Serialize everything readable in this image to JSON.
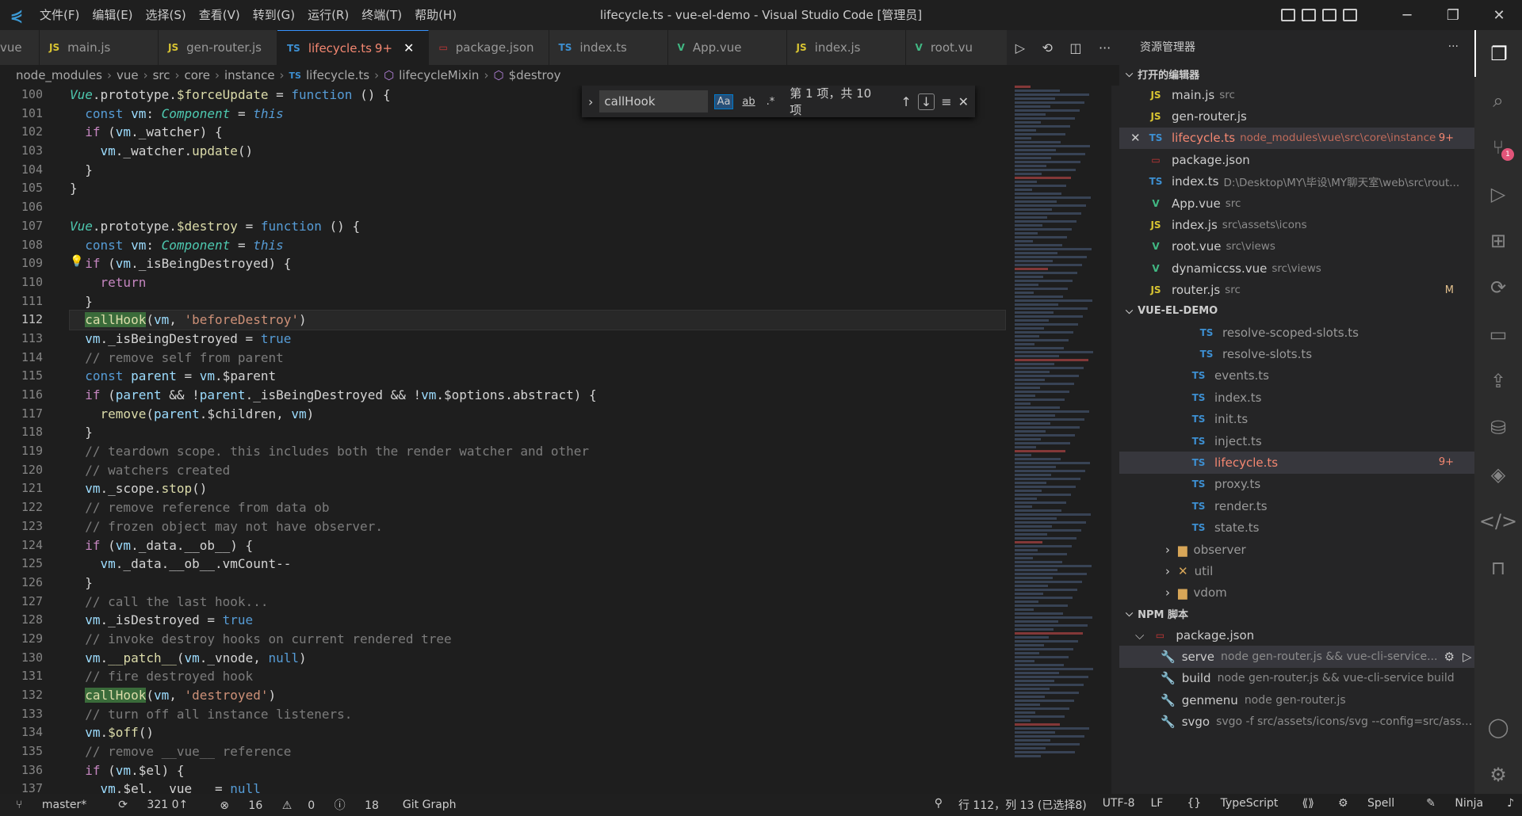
{
  "window": {
    "title": "lifecycle.ts - vue-el-demo - Visual Studio Code [管理员]",
    "menu": [
      "文件(F)",
      "编辑(E)",
      "选择(S)",
      "查看(V)",
      "转到(G)",
      "运行(R)",
      "终端(T)",
      "帮助(H)"
    ],
    "controls": {
      "minimize": "─",
      "maximize": "❐",
      "close": "✕"
    }
  },
  "tabs": [
    {
      "icon": "",
      "label": "vue",
      "type": "vue"
    },
    {
      "icon": "JS",
      "label": "main.js",
      "type": "js"
    },
    {
      "icon": "JS",
      "label": "gen-router.js",
      "type": "js"
    },
    {
      "icon": "TS",
      "label": "lifecycle.ts",
      "type": "ts",
      "active": true,
      "badge": "9+",
      "close": "✕"
    },
    {
      "icon": "▭",
      "label": "package.json",
      "type": "npm"
    },
    {
      "icon": "TS",
      "label": "index.ts",
      "type": "ts"
    },
    {
      "icon": "V",
      "label": "App.vue",
      "type": "vue"
    },
    {
      "icon": "JS",
      "label": "index.js",
      "type": "js"
    },
    {
      "icon": "V",
      "label": "root.vu",
      "type": "vue"
    }
  ],
  "editor_actions": {
    "run": "▷",
    "history": "⟲",
    "split": "◫",
    "more": "···"
  },
  "breadcrumb": [
    "node_modules",
    "vue",
    "src",
    "core",
    "instance",
    "lifecycle.ts",
    "lifecycleMixin",
    "$destroy"
  ],
  "find": {
    "value": "callHook",
    "opt_case": "Aa",
    "opt_word": "ab",
    "opt_regex": ".*",
    "result": "第 1 项，共 10 项",
    "prev": "↑",
    "next": "↓",
    "sel": "≡",
    "close": "✕",
    "toggle": "›"
  },
  "line_numbers": [
    "100",
    "101",
    "102",
    "103",
    "104",
    "105",
    "106",
    "107",
    "108",
    "109",
    "110",
    "111",
    "112",
    "113",
    "114",
    "115",
    "116",
    "117",
    "118",
    "119",
    "120",
    "121",
    "122",
    "123",
    "124",
    "125",
    "126",
    "127",
    "128",
    "129",
    "130",
    "131",
    "132",
    "133",
    "134",
    "135",
    "136",
    "137"
  ],
  "code_plain": {
    "c119": "// teardown scope. this includes both the render watcher and other",
    "c120": "// watchers created",
    "c122": "// remove reference from data ob",
    "c123": "// frozen object may not have observer.",
    "c127": "// call the last hook...",
    "c129": "// invoke destroy hooks on current rendered tree",
    "c131": "// fire destroyed hook",
    "c133": "// turn off all instance listeners.",
    "c135": "// remove __vue__ reference",
    "c114": "// remove self from parent"
  },
  "sidebar": {
    "title": "资源管理器",
    "more": "···",
    "open_editors_title": "打开的编辑器",
    "open_editors": [
      {
        "icon": "JS",
        "type": "js",
        "name": "main.js",
        "desc": "src"
      },
      {
        "icon": "JS",
        "type": "js",
        "name": "gen-router.js",
        "desc": ""
      },
      {
        "icon": "TS",
        "type": "ts",
        "name": "lifecycle.ts",
        "desc": "node_modules\\vue\\src\\core\\instance",
        "badge": "9+",
        "err": true,
        "close": "✕"
      },
      {
        "icon": "▭",
        "type": "npm",
        "name": "package.json",
        "desc": ""
      },
      {
        "icon": "TS",
        "type": "ts",
        "name": "index.ts",
        "desc": "D:\\Desktop\\MY\\毕设\\MY聊天室\\web\\src\\rout..."
      },
      {
        "icon": "V",
        "type": "vue",
        "name": "App.vue",
        "desc": "src"
      },
      {
        "icon": "JS",
        "type": "js",
        "name": "index.js",
        "desc": "src\\assets\\icons"
      },
      {
        "icon": "V",
        "type": "vue",
        "name": "root.vue",
        "desc": "src\\views"
      },
      {
        "icon": "V",
        "type": "vue",
        "name": "dynamiccss.vue",
        "desc": "src\\views"
      },
      {
        "icon": "JS",
        "type": "js",
        "name": "router.js",
        "desc": "src",
        "badge": "M"
      }
    ],
    "project_title": "VUE-EL-DEMO",
    "project_files": [
      {
        "icon": "TS",
        "name": "resolve-scoped-slots.ts",
        "indent": 100
      },
      {
        "icon": "TS",
        "name": "resolve-slots.ts",
        "indent": 100
      },
      {
        "icon": "TS",
        "name": "events.ts",
        "indent": 90
      },
      {
        "icon": "TS",
        "name": "index.ts",
        "indent": 90
      },
      {
        "icon": "TS",
        "name": "init.ts",
        "indent": 90
      },
      {
        "icon": "TS",
        "name": "inject.ts",
        "indent": 90
      },
      {
        "icon": "TS",
        "name": "lifecycle.ts",
        "indent": 90,
        "badge": "9+",
        "err": true,
        "sel": true
      },
      {
        "icon": "TS",
        "name": "proxy.ts",
        "indent": 90
      },
      {
        "icon": "TS",
        "name": "render.ts",
        "indent": 90
      },
      {
        "icon": "TS",
        "name": "state.ts",
        "indent": 90
      }
    ],
    "project_folders": [
      {
        "name": "observer",
        "icon": "▆"
      },
      {
        "name": "util",
        "icon": "✕"
      },
      {
        "name": "vdom",
        "icon": "▆"
      }
    ],
    "npm_title": "NPM 脚本",
    "npm_pkg": "package.json",
    "npm_scripts": [
      {
        "name": "serve",
        "cmd": "node gen-router.js && vue-cli-service..."
      },
      {
        "name": "build",
        "cmd": "node gen-router.js && vue-cli-service build"
      },
      {
        "name": "genmenu",
        "cmd": "node gen-router.js"
      },
      {
        "name": "svgo",
        "cmd": "svgo -f src/assets/icons/svg --config=src/asset..."
      }
    ]
  },
  "activity": {
    "scm_badge": "1"
  },
  "status": {
    "branch": "master*",
    "sync": "321 0↑",
    "problems_err": "16",
    "problems_warn": "0",
    "problems_info": "18",
    "gitgraph": "Git Graph",
    "position": "行 112，列 13 (已选择8)",
    "encoding": "UTF-8",
    "eol": "LF",
    "lang": "TypeScript",
    "spell": "Spell",
    "ninja": "Ninja"
  },
  "colors": {
    "accent": "#3794ff",
    "error": "#f48771",
    "modified": "#e2c08d"
  }
}
